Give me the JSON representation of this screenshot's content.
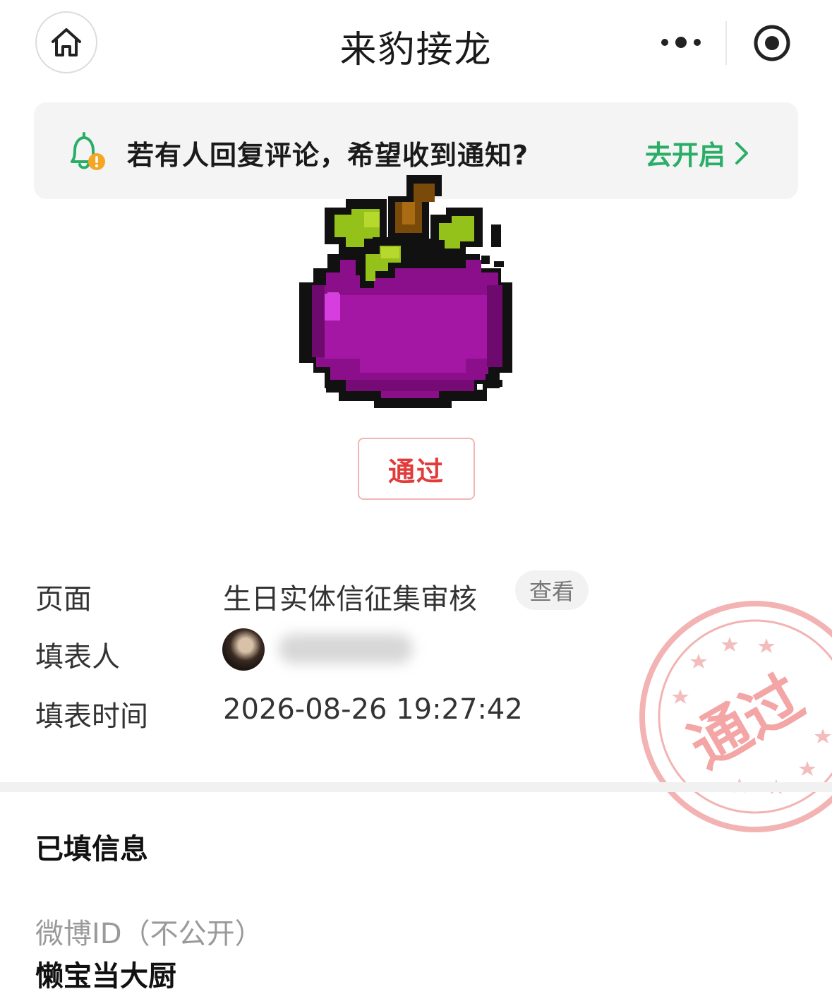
{
  "nav": {
    "title": "来豹接龙",
    "home_icon": "home-icon",
    "more_icon": "more-dots-icon",
    "target_icon": "target-circle-icon"
  },
  "notice": {
    "icon": "bell-alert-icon",
    "text": "若有人回复评论，希望收到通知?",
    "action_label": "去开启",
    "accent": "#2aae67"
  },
  "status": {
    "button_label": "通过",
    "color": "#e23b3b"
  },
  "info": {
    "page_label": "页面",
    "page_value": "生日实体信征集审核",
    "view_label": "查看",
    "filler_label": "填表人",
    "time_label": "填表时间",
    "time_value": "2026-08-26 19:27:42"
  },
  "stamp": {
    "text": "通过",
    "color": "#f2a9a9"
  },
  "filled": {
    "section_title": "已填信息",
    "fields": [
      {
        "label": "微博ID（不公开）",
        "value": "懒宝当大厨"
      }
    ]
  }
}
